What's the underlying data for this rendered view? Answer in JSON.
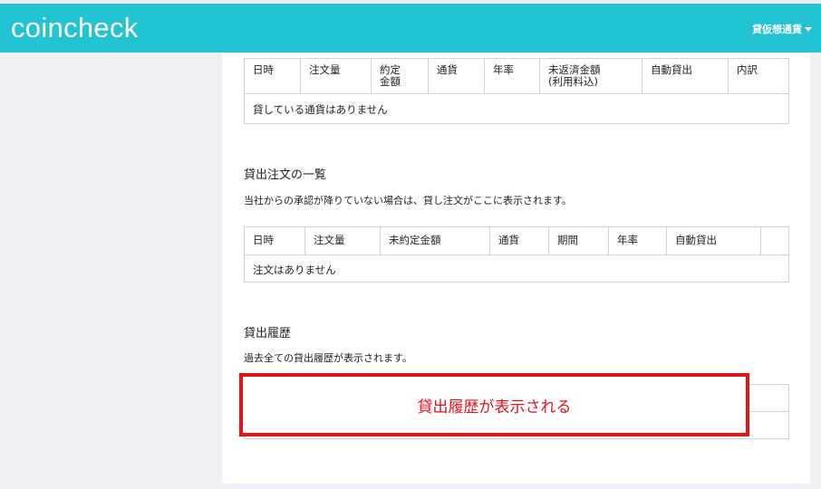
{
  "header": {
    "logo": "coincheck",
    "menu_label": "貸仮想通貨"
  },
  "lending_table": {
    "columns": [
      "日時",
      "注文量",
      "約定\n金額",
      "通貨",
      "年率",
      "未返済金額\n(利用料込)",
      "自動貸出",
      "内訳"
    ],
    "empty_message": "貸している通貨はありません"
  },
  "orders": {
    "title": "貸出注文の一覧",
    "description": "当社からの承認が降りていない場合は、貸し注文がここに表示されます。",
    "columns": [
      "日時",
      "注文量",
      "未約定金額",
      "通貨",
      "期間",
      "年率",
      "自動貸出",
      ""
    ],
    "empty_message": "注文はありません"
  },
  "history": {
    "title": "貸出履歴",
    "description": "過去全ての貸出履歴が表示されます。",
    "overlay_text": "貸出履歴が表示される"
  },
  "colors": {
    "header_bg": "#22c3d2",
    "annotation_red": "#e4141b"
  }
}
